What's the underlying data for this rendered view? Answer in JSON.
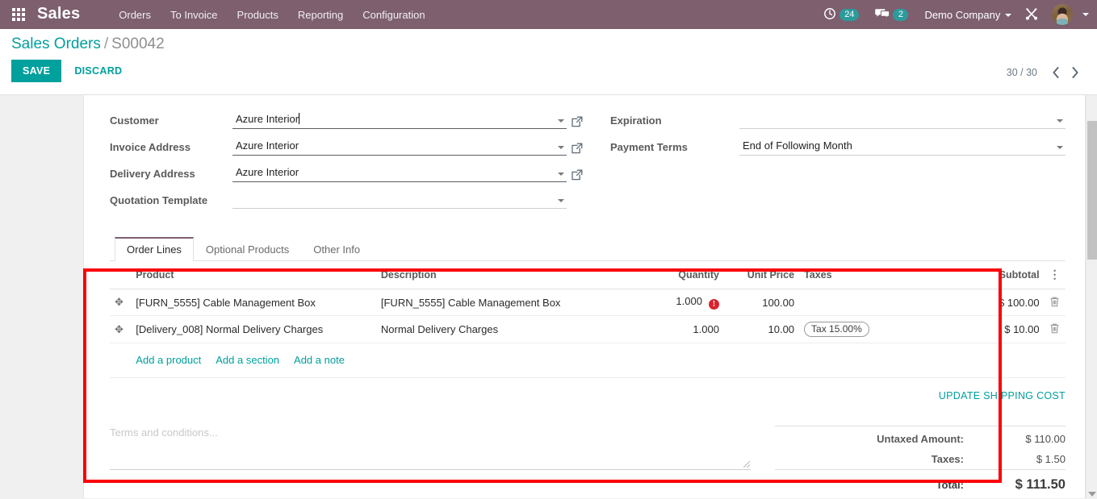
{
  "navbar": {
    "apps_icon": "apps-grid-icon",
    "brand": "Sales",
    "menu": [
      "Orders",
      "To Invoice",
      "Products",
      "Reporting",
      "Configuration"
    ],
    "activity_icon": "clock-activity-icon",
    "activity_count": "24",
    "messages_icon": "chat-bubble-icon",
    "messages_count": "2",
    "company": "Demo Company",
    "debug_icon": "tools-wrench-icon",
    "avatar_icon": "user-avatar"
  },
  "control_panel": {
    "breadcrumb_root": "Sales Orders",
    "breadcrumb_separator": "/",
    "breadcrumb_record": "S00042",
    "save_label": "SAVE",
    "discard_label": "DISCARD",
    "pager_count": "30 / 30",
    "pager_prev_icon": "chevron-left-icon",
    "pager_next_icon": "chevron-right-icon"
  },
  "form": {
    "left": [
      {
        "label": "Customer",
        "value": "Azure Interior",
        "has_ext_link": true,
        "focused": true
      },
      {
        "label": "Invoice Address",
        "value": "Azure Interior",
        "has_ext_link": true,
        "focused": false
      },
      {
        "label": "Delivery Address",
        "value": "Azure Interior",
        "has_ext_link": true,
        "focused": false
      },
      {
        "label": "Quotation Template",
        "value": "",
        "has_ext_link": false,
        "focused": false
      }
    ],
    "right": [
      {
        "label": "Expiration",
        "value": ""
      },
      {
        "label": "Payment Terms",
        "value": "End of Following Month"
      }
    ],
    "ext_link_icon": "external-link-icon",
    "dropdown_icon": "chevron-down-icon"
  },
  "notebook": {
    "tabs": [
      {
        "label": "Order Lines",
        "active": true
      },
      {
        "label": "Optional Products",
        "active": false
      },
      {
        "label": "Other Info",
        "active": false
      }
    ]
  },
  "order_lines": {
    "columns": [
      "Product",
      "Description",
      "Quantity",
      "Unit Price",
      "Taxes",
      "Subtotal"
    ],
    "options_icon": "vertical-dots-icon",
    "rows": [
      {
        "handle_icon": "drag-move-icon",
        "product": "[FURN_5555] Cable Management Box",
        "description": "[FURN_5555] Cable Management Box",
        "quantity": "1.000",
        "quantity_warning_icon": "warning-exclamation-icon",
        "has_warning": true,
        "unit_price": "100.00",
        "taxes": "",
        "subtotal": "$ 100.00",
        "delete_icon": "trash-icon"
      },
      {
        "handle_icon": "drag-move-icon",
        "product": "[Delivery_008] Normal Delivery Charges",
        "description": "Normal Delivery Charges",
        "quantity": "1.000",
        "has_warning": false,
        "unit_price": "10.00",
        "taxes": "Tax 15.00%",
        "subtotal": "$ 10.00",
        "delete_icon": "trash-icon"
      }
    ],
    "add_links": [
      "Add a product",
      "Add a section",
      "Add a note"
    ]
  },
  "terms": {
    "placeholder": "Terms and conditions..."
  },
  "totals": {
    "update_shipping_label": "UPDATE SHIPPING COST",
    "rows": [
      {
        "label": "Untaxed Amount:",
        "value": "$ 110.00"
      },
      {
        "label": "Taxes:",
        "value": "$ 1.50"
      }
    ],
    "grand_label": "Total:",
    "grand_value": "$ 111.50"
  },
  "colors": {
    "navbar_bg": "#7d5f6e",
    "accent_teal": "#00a09d",
    "badge_teal": "#2d9b9b",
    "highlight_red": "#fb0007",
    "warning_red": "#d9232d"
  }
}
